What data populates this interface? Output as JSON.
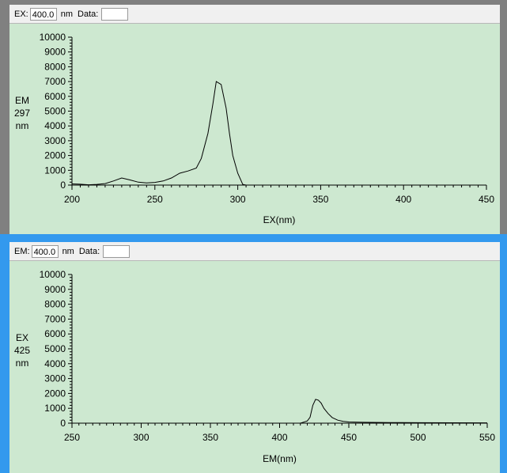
{
  "panels": [
    {
      "id": "ex",
      "toolbar": {
        "mode_label": "EX:",
        "value": "400.0",
        "unit": "nm",
        "data_label": "Data:",
        "data_value": ""
      },
      "ylabel_lines": [
        "EM",
        "297",
        "nm"
      ]
    },
    {
      "id": "em",
      "toolbar": {
        "mode_label": "EM:",
        "value": "400.0",
        "unit": "nm",
        "data_label": "Data:",
        "data_value": ""
      },
      "ylabel_lines": [
        "EX",
        "425",
        "nm"
      ]
    }
  ],
  "colors": {
    "plot_bg": "#cde8d0",
    "active_border": "#3399ee",
    "inactive_border": "#808080",
    "line": "#000000"
  },
  "chart_data": [
    {
      "type": "line",
      "title": "",
      "xlabel": "EX(nm)",
      "ylabel": "EM 297 nm",
      "xlim": [
        200,
        450
      ],
      "ylim": [
        0,
        10000
      ],
      "xticks": [
        200,
        250,
        300,
        350,
        400,
        450
      ],
      "yticks": [
        0,
        1000,
        2000,
        3000,
        4000,
        5000,
        6000,
        7000,
        8000,
        9000,
        10000
      ],
      "grid": false,
      "series": [
        {
          "x": [
            200,
            205,
            210,
            215,
            220,
            225,
            230,
            235,
            240,
            245,
            250,
            255,
            260,
            265,
            270,
            275,
            278,
            282,
            285,
            287,
            290,
            293,
            295,
            297,
            300,
            303,
            305
          ],
          "y": [
            80,
            60,
            20,
            50,
            100,
            280,
            480,
            350,
            200,
            150,
            180,
            280,
            480,
            800,
            950,
            1150,
            1800,
            3500,
            5500,
            7000,
            6800,
            5200,
            3500,
            2000,
            800,
            50,
            0
          ]
        }
      ]
    },
    {
      "type": "line",
      "title": "",
      "xlabel": "EM(nm)",
      "ylabel": "EX 425 nm",
      "xlim": [
        250,
        550
      ],
      "ylim": [
        0,
        10000
      ],
      "xticks": [
        250,
        300,
        350,
        400,
        450,
        500,
        550
      ],
      "yticks": [
        0,
        1000,
        2000,
        3000,
        4000,
        5000,
        6000,
        7000,
        8000,
        9000,
        10000
      ],
      "grid": false,
      "series": [
        {
          "x": [
            415,
            420,
            422,
            424,
            426,
            428,
            430,
            432,
            435,
            438,
            442,
            446,
            450,
            460,
            480,
            500,
            550
          ],
          "y": [
            0,
            150,
            400,
            1200,
            1600,
            1550,
            1350,
            1000,
            650,
            380,
            200,
            120,
            80,
            60,
            40,
            30,
            20
          ]
        }
      ]
    }
  ]
}
